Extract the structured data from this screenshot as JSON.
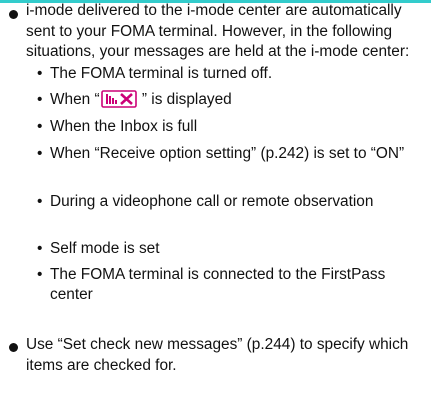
{
  "bullets": [
    {
      "text": "i-mode delivered to the i-mode center are automatically sent to your FOMA terminal. However, in the following situations, your messages are held at the i-mode center:",
      "items": [
        "The FOMA terminal is turned off.",
        {
          "pre": "When “",
          "icon": "out-of-service-antenna-icon",
          "post": " ” is displayed"
        },
        "When the Inbox is full",
        "When “Receive option setting” (p.242) is set to “ON”",
        "During a videophone call or remote observation",
        "Self mode is set",
        "The FOMA terminal is connected to the FirstPass center"
      ]
    },
    {
      "text": "Use “Set check new messages” (p.244) to specify which items are checked for."
    }
  ],
  "colors": {
    "top_rule": "#33cccc",
    "icon_magenta": "#cc0077"
  }
}
